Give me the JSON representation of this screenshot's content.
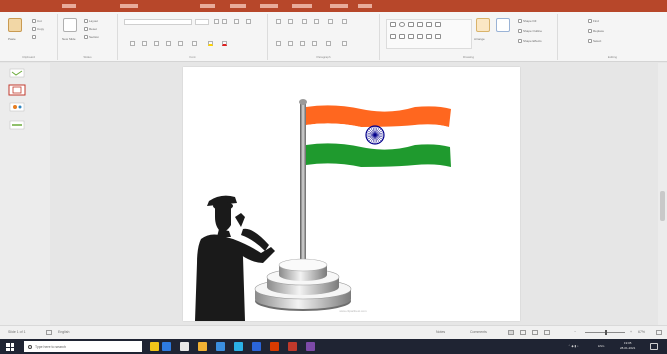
{
  "app": {
    "accent_color": "#b7472a",
    "ribbon_groups": [
      "Clipboard",
      "Slides",
      "Font",
      "Paragraph",
      "Drawing",
      "Editing"
    ]
  },
  "ribbon": {
    "clipboard": {
      "paste_label": "Paste",
      "cut_label": "Cut",
      "copy_label": "Copy",
      "format_label": "Format Painter"
    },
    "slides": {
      "new_slide_label": "New Slide",
      "layout_label": "Layout",
      "reset_label": "Reset",
      "section_label": "Section"
    },
    "drawing": {
      "arrange_label": "Arrange",
      "quick_styles_label": "Quick Styles",
      "shape_fill_label": "Shape Fill",
      "shape_outline_label": "Shape Outline",
      "shape_effects_label": "Shape Effects"
    },
    "editing": {
      "find_label": "Find",
      "replace_label": "Replace",
      "select_label": "Select"
    }
  },
  "slide": {
    "watermark": "www.clipartbest.com",
    "flag_colors": {
      "saffron": "#ff671f",
      "white": "#ffffff",
      "green": "#1f9a2e",
      "chakra": "#06038d"
    }
  },
  "statusbar": {
    "slide_info": "Slide 1 of 1",
    "language": "English",
    "notes_label": "Notes",
    "comments_label": "Comments",
    "zoom_value": "67%"
  },
  "taskbar": {
    "search_placeholder": "Type here to search",
    "tray_text": "ENG",
    "time": "19:05",
    "date": "28-01-2021"
  }
}
